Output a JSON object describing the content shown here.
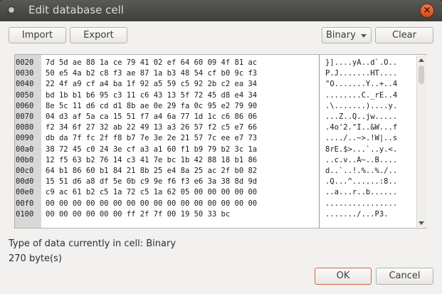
{
  "window": {
    "title": "Edit database cell",
    "close_glyph": "×"
  },
  "toolbar": {
    "import_label": "Import",
    "export_label": "Export",
    "mode_value": "Binary",
    "clear_label": "Clear"
  },
  "hex": {
    "rows": [
      {
        "addr": "0020",
        "hex": "7d 5d ae 88 1a ce 79 41 02 ef 64 60 09 4f 81 ac",
        "ascii": "}]....yA..d`.O.."
      },
      {
        "addr": "0030",
        "hex": "50 e5 4a b2 c8 f3 ae 87 1a b3 48 54 cf b0 9c f3",
        "ascii": "P.J.......HT...."
      },
      {
        "addr": "0040",
        "hex": "22 4f a9 cf a4 ba 1f 92 a5 59 c5 92 2b c2 ea 34",
        "ascii": "\"O.......Y..+..4"
      },
      {
        "addr": "0050",
        "hex": "bd 1b b1 b6 95 c3 11 c6 43 13 5f 72 45 d8 e4 34",
        "ascii": "........C._rE..4"
      },
      {
        "addr": "0060",
        "hex": "8e 5c 11 d6 cd d1 8b ae 0e 29 fa 0c 95 e2 79 90",
        "ascii": ".\\.......)....y."
      },
      {
        "addr": "0070",
        "hex": "04 d3 af 5a ca 15 51 f7 a4 6a 77 1d 1c c6 86 06",
        "ascii": "...Z..Q..jw....."
      },
      {
        "addr": "0080",
        "hex": "f2 34 6f 27 32 ab 22 49 13 a3 26 57 f2 c5 e7 66",
        "ascii": ".4o'2.\"I..&W...f"
      },
      {
        "addr": "0090",
        "hex": "db da 7f fc 2f f8 b7 7e 3e 2e 21 57 7c ee e7 73",
        "ascii": "..../..~>.!W|..s"
      },
      {
        "addr": "00a0",
        "hex": "38 72 45 c0 24 3e cf a3 a1 60 f1 b9 79 b2 3c 1a",
        "ascii": "8rE.$>...`..y.<."
      },
      {
        "addr": "00b0",
        "hex": "12 f5 63 b2 76 14 c3 41 7e bc 1b 42 88 18 b1 86",
        "ascii": "..c.v..A~..B...."
      },
      {
        "addr": "00c0",
        "hex": "64 b1 86 60 b1 84 21 8b 25 e4 8a 25 ac 2f b0 82",
        "ascii": "d..`..!.%..%./.."
      },
      {
        "addr": "00d0",
        "hex": "15 51 d6 a8 df 5e 0b c9 9e f6 f3 e6 3a 38 8d 9d",
        "ascii": ".Q...^......:8.."
      },
      {
        "addr": "00e0",
        "hex": "c9 ac 61 b2 c5 1a 72 c5 1a 62 05 00 00 00 00 00",
        "ascii": "..a...r..b......"
      },
      {
        "addr": "00f0",
        "hex": "00 00 00 00 00 00 00 00 00 00 00 00 00 00 00 00",
        "ascii": "................"
      },
      {
        "addr": "0100",
        "hex": "00 00 00 00 00 00 ff 2f 7f 00 19 50 33 bc",
        "ascii": "......./...P3."
      }
    ]
  },
  "status": {
    "type_text": "Type of data currently in cell: Binary",
    "size_text": "270 byte(s)"
  },
  "dialog": {
    "ok_label": "OK",
    "cancel_label": "Cancel"
  }
}
